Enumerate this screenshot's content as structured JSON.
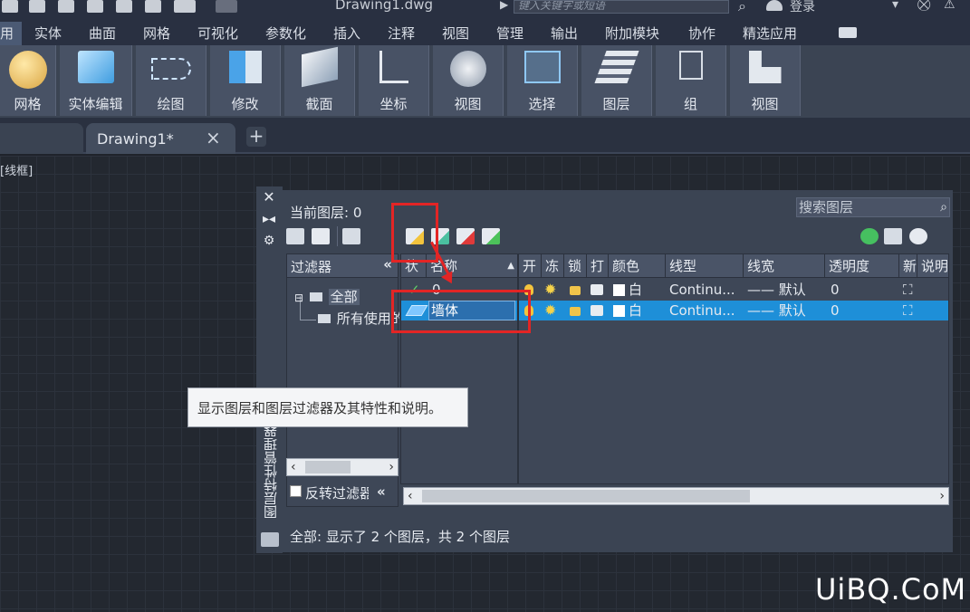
{
  "titlebar": {
    "document_title": "Drawing1.dwg",
    "search_placeholder": "键入关键字或短语",
    "login_label": "登录"
  },
  "menu": {
    "items": [
      "用",
      "实体",
      "曲面",
      "网格",
      "可视化",
      "参数化",
      "插入",
      "注释",
      "视图",
      "管理",
      "输出",
      "附加模块",
      "协作",
      "精选应用"
    ]
  },
  "ribbon": {
    "buttons": [
      "网格",
      "实体编辑",
      "绘图",
      "修改",
      "截面",
      "坐标",
      "视图",
      "选择",
      "图层",
      "组",
      "视图"
    ]
  },
  "tabs": {
    "doc_tab_label": "Drawing1*",
    "close_glyph": "×",
    "plus_glyph": "+"
  },
  "viewport": {
    "label": "[线框]"
  },
  "palette": {
    "title": "图层特性管理器",
    "current_layer": "当前图层: 0",
    "search_placeholder": "搜索图层",
    "filter_header": "过滤器",
    "collapse_glyph": "«",
    "tree_all": "全部",
    "tree_used": "所有使用的图层",
    "invert_filter": "反转过滤器",
    "columns": [
      "状",
      "名称",
      "开",
      "冻",
      "锁",
      "打",
      "颜色",
      "线型",
      "线宽",
      "透明度",
      "新",
      "说明"
    ],
    "rows": [
      {
        "status": "✓",
        "name": "0",
        "color_name": "白",
        "linetype": "Continu...",
        "lineweight": "—— 默认",
        "transparency": "0"
      },
      {
        "status": "",
        "name": "墙体",
        "color_name": "白",
        "linetype": "Continu...",
        "lineweight": "—— 默认",
        "transparency": "0"
      }
    ],
    "status_text": "全部: 显示了 2 个图层，共 2 个图层",
    "tooltip": "显示图层和图层过滤器及其特性和说明。"
  },
  "colors": {
    "highlight": "#e32525",
    "selected_row": "#1e8fd8"
  },
  "watermark": "UiBQ.CoM"
}
